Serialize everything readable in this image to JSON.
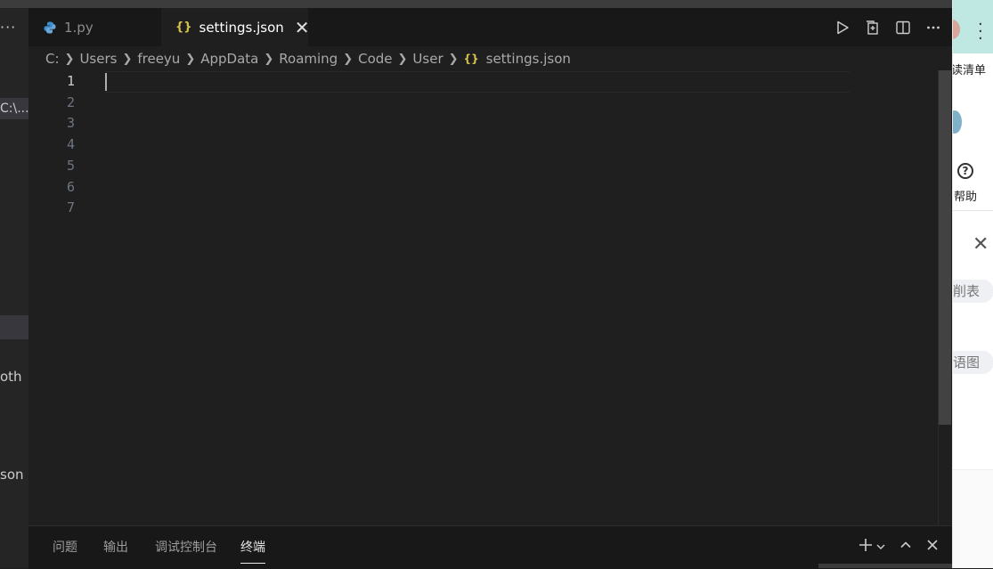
{
  "editor_tabs": [
    {
      "label": "1.py",
      "icon": "python-icon",
      "active": false
    },
    {
      "label": "settings.json",
      "icon": "json-braces-icon",
      "active": true
    }
  ],
  "tab_close_glyph": "✕",
  "breadcrumb": [
    "C:",
    "Users",
    "freeyu",
    "AppData",
    "Roaming",
    "Code",
    "User",
    "settings.json"
  ],
  "line_numbers": [
    "1",
    "2",
    "3",
    "4",
    "5",
    "6",
    "7"
  ],
  "panel_tabs": [
    {
      "label": "问题",
      "active": false
    },
    {
      "label": "输出",
      "active": false
    },
    {
      "label": "调试控制台",
      "active": false
    },
    {
      "label": "终端",
      "active": true
    }
  ],
  "left_sidebar": {
    "ellipsis": "···",
    "path_item": "C:\\...",
    "fragments": [
      "oth",
      "son"
    ]
  },
  "browser_side": {
    "reading_list": "读清单",
    "help_label": "帮助",
    "help_icon": "?",
    "close_icon": "✕",
    "pill_1": "削表",
    "pill_2": "语图"
  },
  "colors": {
    "editor_bg": "#1f1f1f",
    "tabbar_bg": "#181818",
    "json_icon": "#d7c34a",
    "python_icon": "#3b8ed0"
  }
}
